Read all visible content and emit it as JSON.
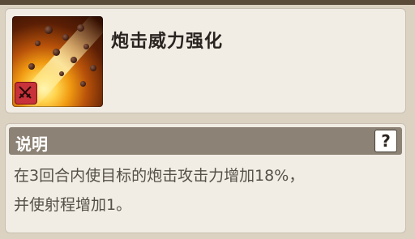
{
  "skill": {
    "name": "炮击威力强化",
    "icon": "cannon-barrage-icon",
    "badge_icon": "crossed-swords-icon",
    "badge_color": "#c8323a"
  },
  "description": {
    "title": "说明",
    "help_label": "?",
    "lines": [
      "在3回合内使目标的炮击攻击力增加18%，",
      "并使射程增加1。"
    ]
  },
  "colors": {
    "panel_bg": "#f1ece4",
    "header_bg": "#8c8275",
    "text": "#555048",
    "title_text": "#2a2420"
  }
}
